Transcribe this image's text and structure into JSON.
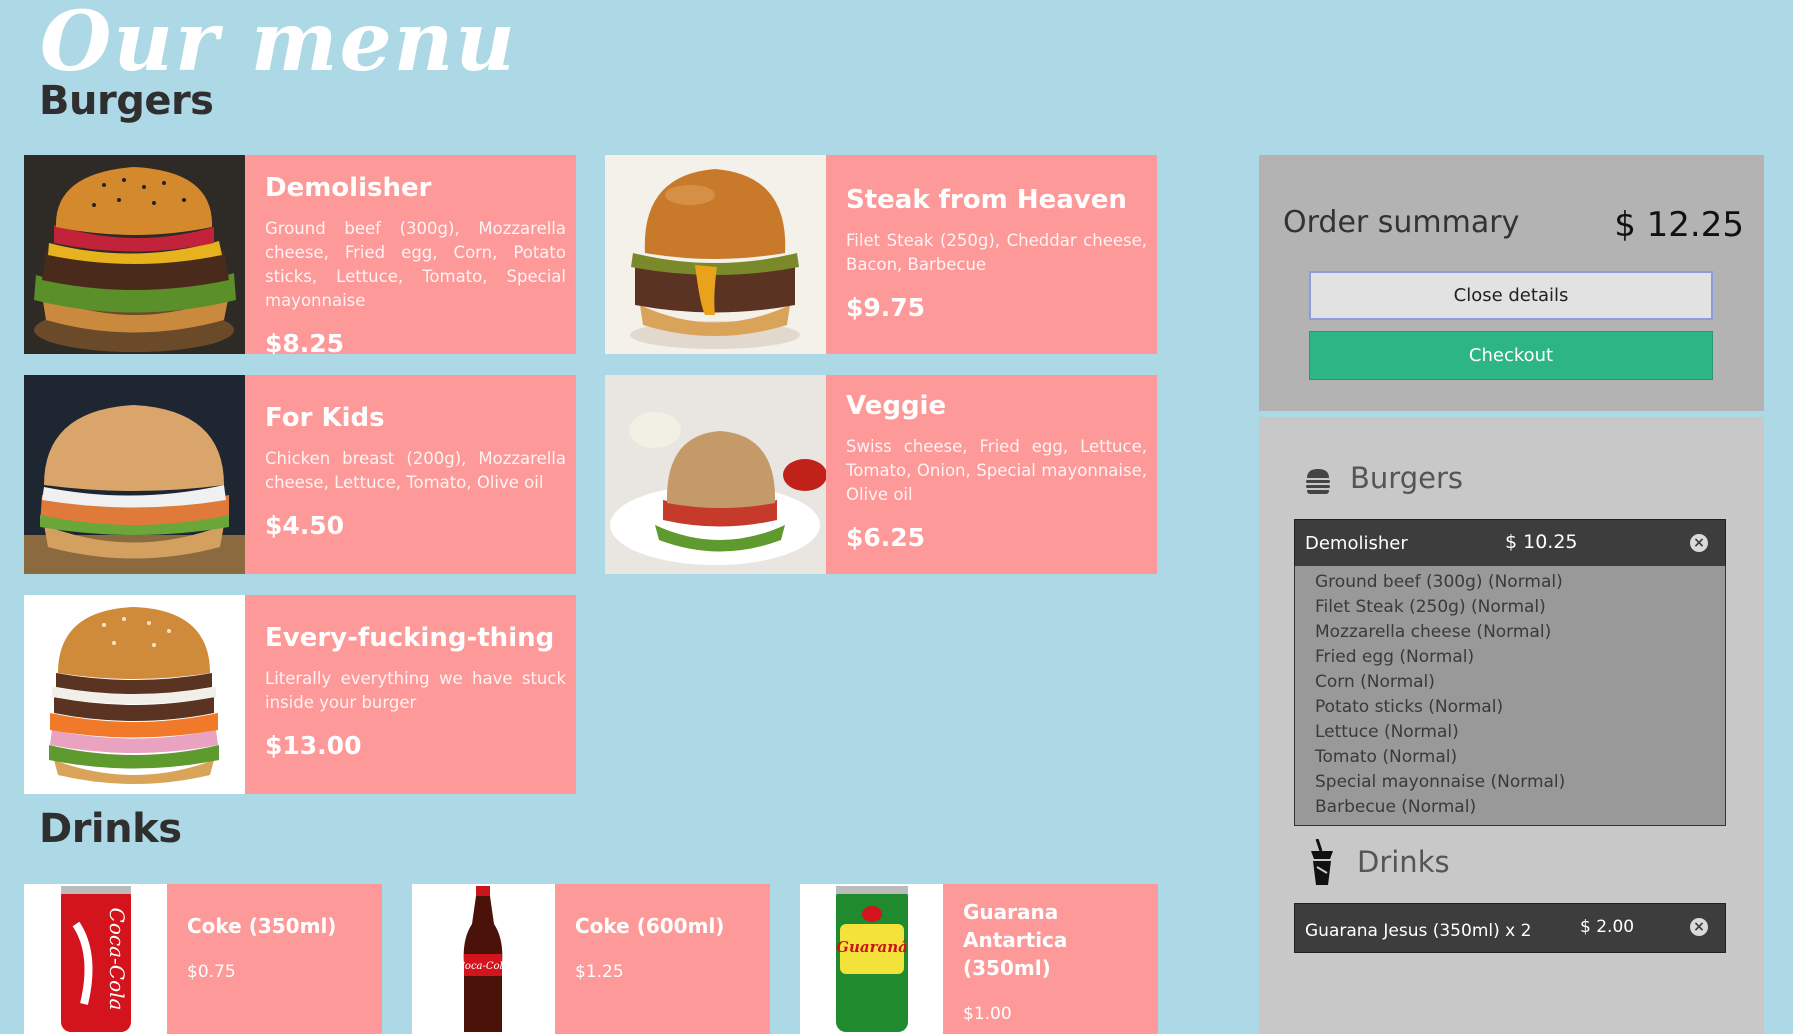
{
  "logo": "Our menu",
  "sections": {
    "burgers": "Burgers",
    "drinks": "Drinks"
  },
  "burgers": [
    {
      "title": "Demolisher",
      "desc": "Ground beef (300g), Mozzarella cheese, Fried egg, Corn, Potato sticks, Lettuce, Tomato, Special mayonnaise",
      "price": "$8.25",
      "image": "burger-photo"
    },
    {
      "title": "Steak from Heaven",
      "desc": "Filet Steak (250g), Cheddar cheese, Bacon, Barbecue",
      "price": "$9.75",
      "image": "burger-photo"
    },
    {
      "title": "For Kids",
      "desc": "Chicken breast (200g), Mozzarella cheese, Lettuce, Tomato, Olive oil",
      "price": "$4.50",
      "image": "burger-photo"
    },
    {
      "title": "Veggie",
      "desc": "Swiss cheese, Fried egg, Lettuce, Tomato, Onion, Special mayonnaise, Olive oil",
      "price": "$6.25",
      "image": "burger-photo"
    },
    {
      "title": "Every-fucking-thing",
      "desc": "Literally everything we have stuck inside your burger",
      "price": "$13.00",
      "image": "burger-photo"
    }
  ],
  "drinks": [
    {
      "title": "Coke (350ml)",
      "price": "$0.75",
      "image": "soda-can-photo"
    },
    {
      "title": "Coke (600ml)",
      "price": "$1.25",
      "image": "soda-bottle-photo"
    },
    {
      "title": "Guarana Antartica (350ml)",
      "price": "$1.00",
      "image": "soda-can-photo"
    }
  ],
  "summary": {
    "label": "Order summary",
    "total": "$ 12.25",
    "close_label": "Close details",
    "checkout_label": "Checkout"
  },
  "order": {
    "burgers_label": "Burgers",
    "drinks_label": "Drinks",
    "burger_item": {
      "name": "Demolisher",
      "price": "$ 10.25",
      "ingredients": [
        "Ground beef (300g) (Normal)",
        "Filet Steak (250g) (Normal)",
        "Mozzarella cheese (Normal)",
        "Fried egg (Normal)",
        "Corn (Normal)",
        "Potato sticks (Normal)",
        "Lettuce (Normal)",
        "Tomato (Normal)",
        "Special mayonnaise (Normal)",
        "Barbecue (Normal)"
      ]
    },
    "drink_item": {
      "name": "Guarana Jesus (350ml) x 2",
      "price": "$ 2.00"
    }
  },
  "colors": {
    "background": "#add8e6",
    "card": "#fe9999",
    "checkout": "#2eb584",
    "summary": "#b3b3b3"
  },
  "icons": {
    "burger": "burger-icon",
    "drink": "drink-cup-icon",
    "remove": "remove-circle-icon"
  }
}
